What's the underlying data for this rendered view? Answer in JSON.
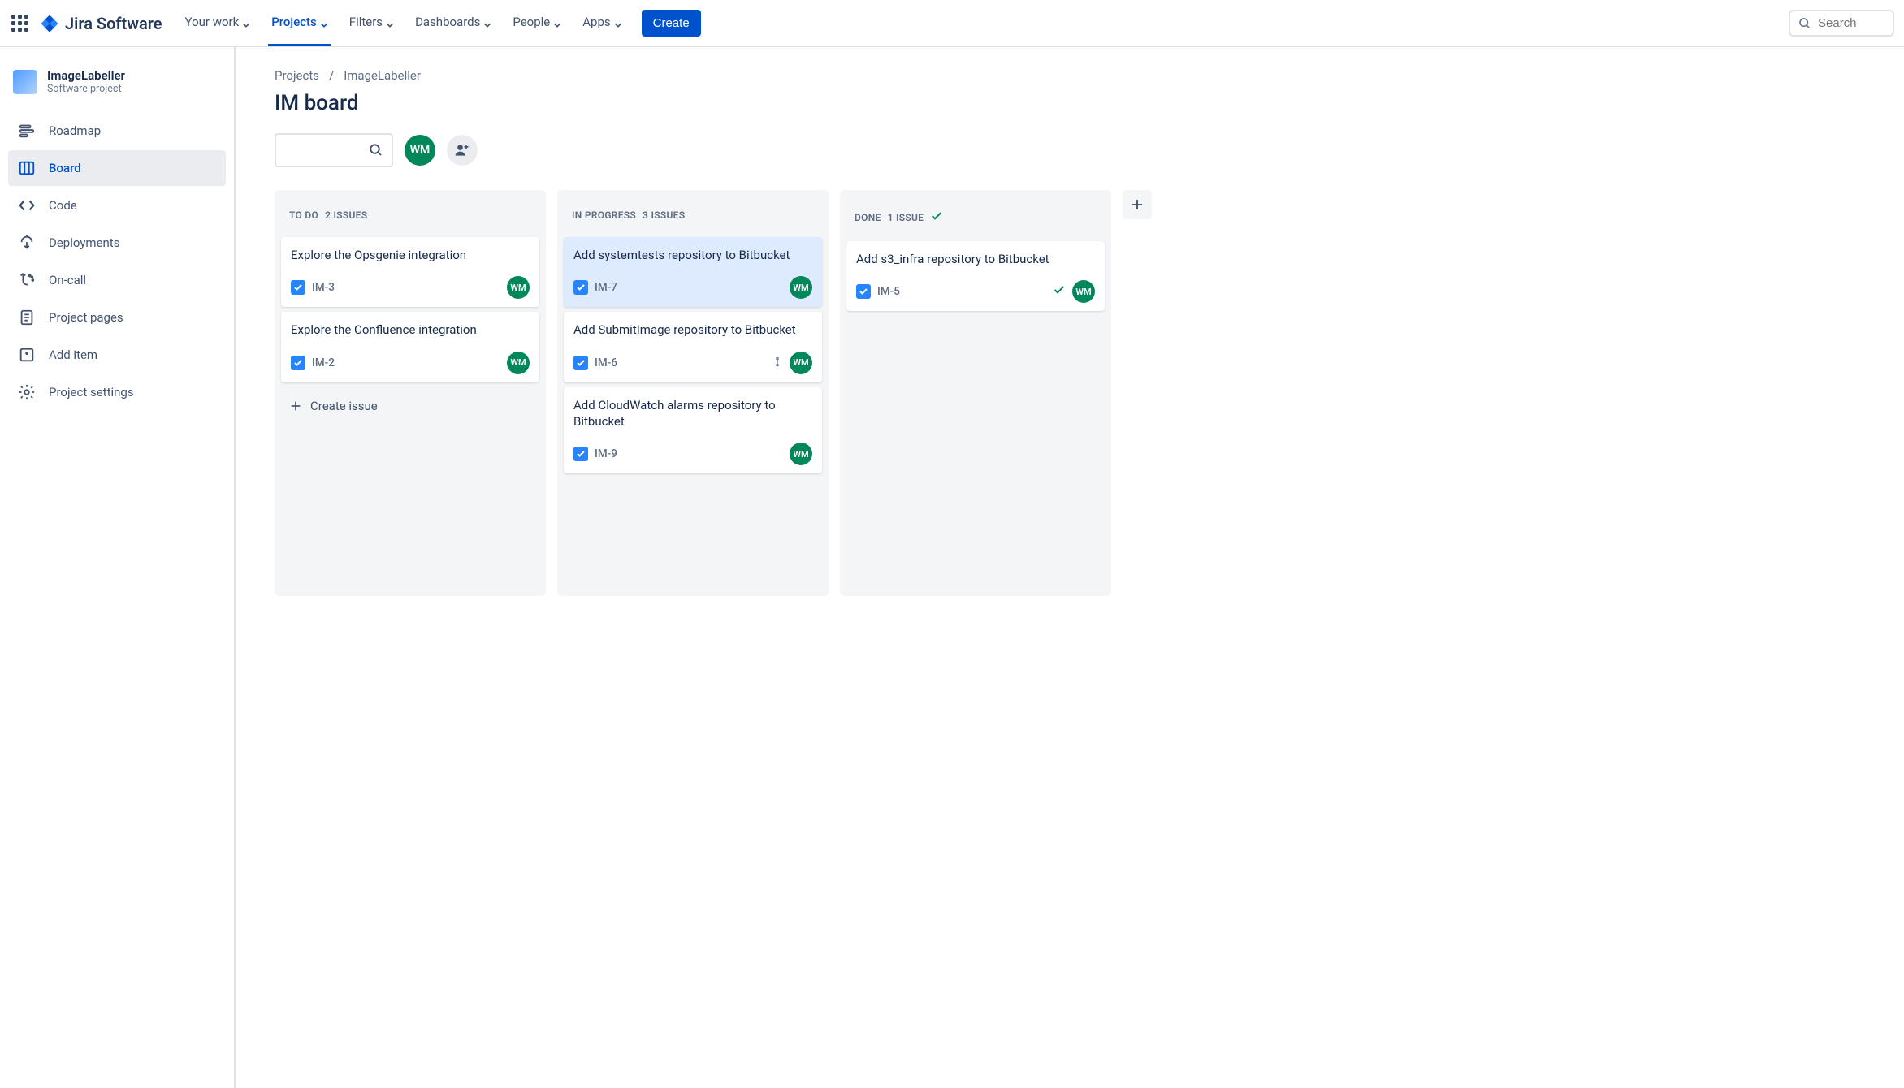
{
  "topnav": {
    "logo_text": "Jira Software",
    "items": [
      "Your work",
      "Projects",
      "Filters",
      "Dashboards",
      "People",
      "Apps"
    ],
    "active_index": 1,
    "create_label": "Create",
    "search_placeholder": "Search"
  },
  "project": {
    "name": "ImageLabeller",
    "subtitle": "Software project"
  },
  "sidebar": {
    "items": [
      {
        "label": "Roadmap"
      },
      {
        "label": "Board"
      },
      {
        "label": "Code"
      },
      {
        "label": "Deployments"
      },
      {
        "label": "On-call"
      },
      {
        "label": "Project pages"
      },
      {
        "label": "Add item"
      },
      {
        "label": "Project settings"
      }
    ],
    "active_index": 1
  },
  "breadcrumb": {
    "root": "Projects",
    "current": "ImageLabeller"
  },
  "page_title": "IM board",
  "user_initials": "WM",
  "columns": [
    {
      "name": "To Do",
      "count_label": "2 issues",
      "done": false,
      "cards": [
        {
          "title": "Explore the Opsgenie integration",
          "key": "IM-3",
          "assignee": "WM",
          "selected": false,
          "priority": null,
          "done": false
        },
        {
          "title": "Explore the Confluence integration",
          "key": "IM-2",
          "assignee": "WM",
          "selected": false,
          "priority": null,
          "done": false
        }
      ],
      "show_create": true
    },
    {
      "name": "In Progress",
      "count_label": "3 issues",
      "done": false,
      "cards": [
        {
          "title": "Add systemtests repository to Bitbucket",
          "key": "IM-7",
          "assignee": "WM",
          "selected": true,
          "priority": null,
          "done": false
        },
        {
          "title": "Add SubmitImage repository to Bitbucket",
          "key": "IM-6",
          "assignee": "WM",
          "selected": false,
          "priority": "medium",
          "done": false
        },
        {
          "title": "Add CloudWatch alarms repository to Bitbucket",
          "key": "IM-9",
          "assignee": "WM",
          "selected": false,
          "priority": null,
          "done": false
        }
      ],
      "show_create": false
    },
    {
      "name": "Done",
      "count_label": "1 issue",
      "done": true,
      "cards": [
        {
          "title": "Add s3_infra repository to Bitbucket",
          "key": "IM-5",
          "assignee": "WM",
          "selected": false,
          "priority": null,
          "done": true
        }
      ],
      "show_create": false
    }
  ],
  "create_issue_label": "Create issue"
}
